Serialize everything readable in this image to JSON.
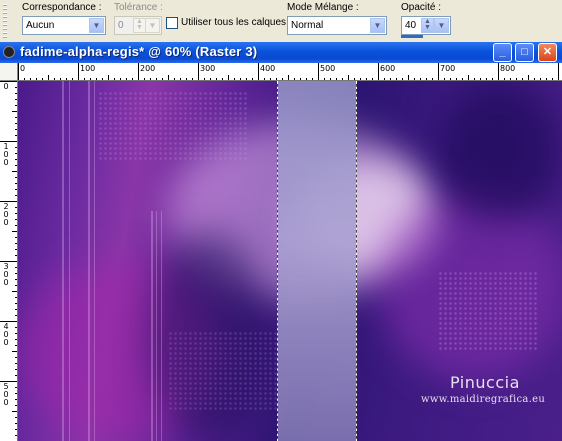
{
  "options": {
    "correspondance": {
      "label": "Correspondance :",
      "value": "Aucun"
    },
    "tolerance": {
      "label": "Tolérance :",
      "value": "0"
    },
    "all_layers": {
      "label": "Utiliser tous les calques",
      "checked": false
    },
    "blend_mode": {
      "label": "Mode Mélange :",
      "value": "Normal"
    },
    "opacity": {
      "label": "Opacité :",
      "value": "40"
    }
  },
  "window": {
    "title": "fadime-alpha-regis* @  60% (Raster 3)",
    "minimize": "_",
    "maximize": "□",
    "close": "✕"
  },
  "ruler": {
    "top": [
      "0",
      "100",
      "200",
      "300",
      "400",
      "500",
      "600",
      "700",
      "800"
    ],
    "left": [
      "0",
      "1\n0\n0",
      "2\n0\n0",
      "3\n0\n0",
      "4\n0\n0",
      "5\n0\n0"
    ]
  },
  "watermark": {
    "name": "Pinuccia",
    "url": "www.maidiregrafica.eu"
  }
}
